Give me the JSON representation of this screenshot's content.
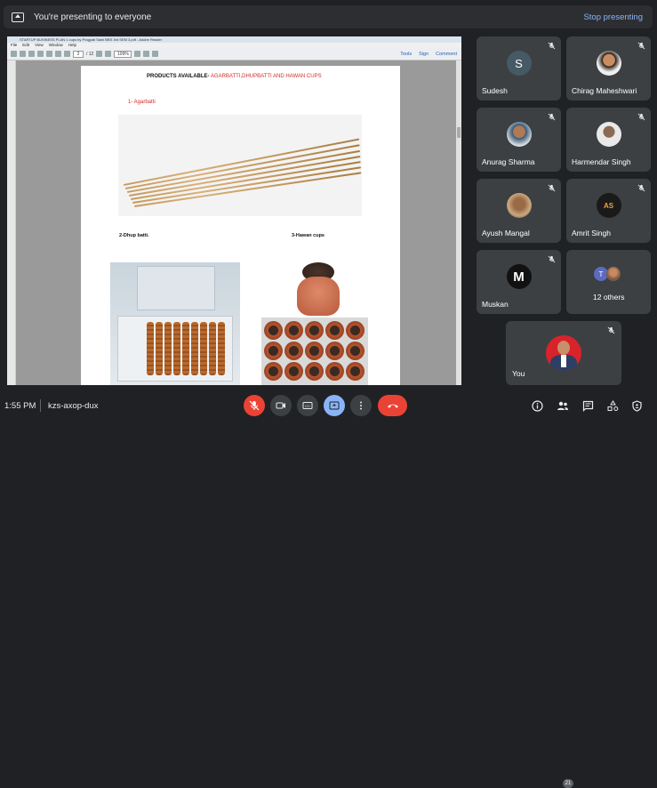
{
  "banner": {
    "message": "You're presenting to everyone",
    "stop_label": "Stop presenting"
  },
  "pdf": {
    "window_title": "STARTUP BUSINESS PLAN 1 cups by Pragyati Saini BBS 3rd SEM 3.pdf - Adobe Reader",
    "menu": [
      "File",
      "Edit",
      "View",
      "Window",
      "Help"
    ],
    "page_current": "2",
    "page_total": "/ 12",
    "zoom": "109%",
    "tool_links": [
      "Tools",
      "Sign",
      "Comment"
    ],
    "heading_black": "PRODUCTS AVAILABLE-",
    "heading_red": " AGARBATTI,DHUPBATTI AND HAWAN CUPS",
    "item1": "1-   Agarbatti",
    "item2": "2-Dhup batti.",
    "item3": "3-Hawan cups"
  },
  "participants": [
    {
      "name": "Sudesh",
      "initial": "S",
      "avatar_color": "#455a64"
    },
    {
      "name": "Chirag Maheshwari"
    },
    {
      "name": "Anurag Sharma"
    },
    {
      "name": "Harmendar Singh"
    },
    {
      "name": "Ayush Mangal"
    },
    {
      "name": "Amrit Singh",
      "avatar_text": "AS"
    },
    {
      "name": "Muskan",
      "initial": "M",
      "avatar_color": "#111111"
    },
    {
      "name": "12 others",
      "mini_initial": "T"
    }
  ],
  "self_tile": {
    "name": "You"
  },
  "bottom": {
    "time": "1:55 PM",
    "meeting_code": "kzs-axop-dux",
    "people_count": "21"
  },
  "colors": {
    "accent_blue": "#8ab4f8",
    "danger_red": "#ea4335",
    "tile_bg": "#3c4043",
    "background": "#202124"
  }
}
